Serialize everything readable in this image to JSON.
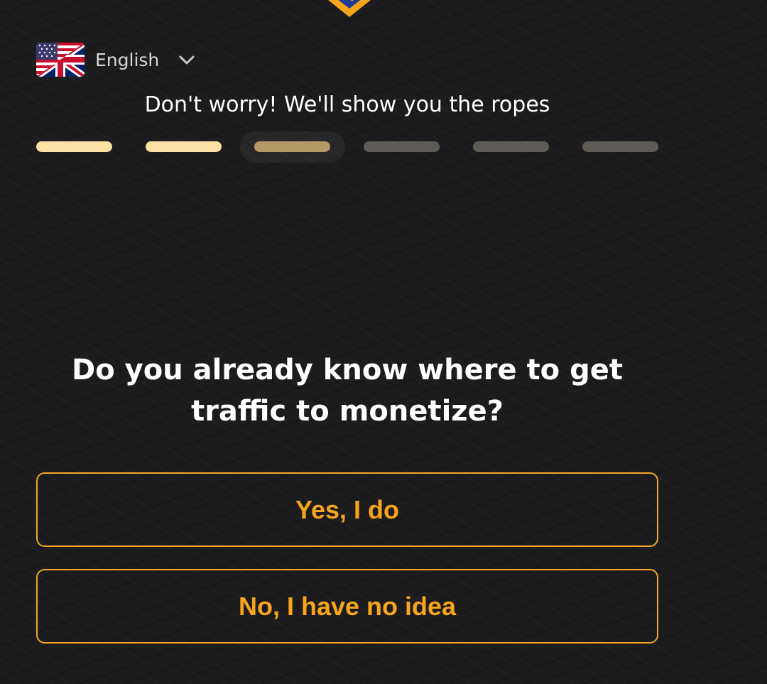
{
  "brand": {
    "logo_icon": "shield-logo-icon",
    "accent_color": "#f5a623"
  },
  "language": {
    "flag_icon": "us-uk-flag-icon",
    "label": "English",
    "dropdown_icon": "chevron-down-icon"
  },
  "onboarding": {
    "subtitle": "Don't worry! We'll show you the ropes",
    "progress": {
      "total_steps": 6,
      "current_step": 3,
      "steps": [
        "done",
        "done",
        "current",
        "todo",
        "todo",
        "todo"
      ]
    },
    "question": "Do you already know where to get traffic to monetize?",
    "answers": {
      "yes_label": "Yes, I do",
      "no_label": "No, I have no idea"
    }
  }
}
